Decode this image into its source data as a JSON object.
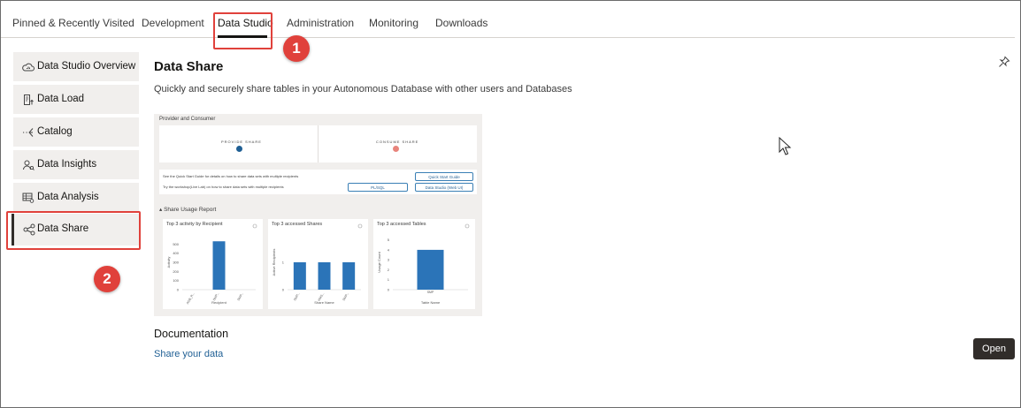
{
  "tabs": [
    {
      "label": "Pinned & Recently Visited"
    },
    {
      "label": "Development"
    },
    {
      "label": "Data Studio",
      "active": true
    },
    {
      "label": "Administration"
    },
    {
      "label": "Monitoring"
    },
    {
      "label": "Downloads"
    }
  ],
  "sidebar": {
    "items": [
      {
        "label": "Data Studio Overview",
        "icon": "cloud-chart-icon"
      },
      {
        "label": "Data Load",
        "icon": "document-upload-icon"
      },
      {
        "label": "Catalog",
        "icon": "catalog-icon"
      },
      {
        "label": "Data Insights",
        "icon": "person-search-icon"
      },
      {
        "label": "Data Analysis",
        "icon": "table-analysis-icon"
      },
      {
        "label": "Data Share",
        "icon": "share-icon",
        "active": true
      }
    ]
  },
  "callouts": [
    {
      "number": "1"
    },
    {
      "number": "2"
    }
  ],
  "main": {
    "title": "Data Share",
    "subtitle": "Quickly and securely share tables in your Autonomous Database with other users and Databases",
    "preview": {
      "header": "Provider and Consumer",
      "provide_label": "PROVIDE SHARE",
      "consume_label": "CONSUME SHARE",
      "guide_text": "See the Quick Start Guide for details on how to share data sets with multiple recipients",
      "workshop_text": "Try the workshop(Live Lab) on how to share data sets with multiple recipients",
      "quick_start_btn": "Quick Start Guide",
      "plsql_btn": "PL/SQL",
      "data_studio_btn": "Data Studio (Web UI)",
      "usage_report": "▴ Share Usage Report",
      "charts": [
        {
          "title": "Top 3 activity by Recipient",
          "ylabel": "Activity",
          "xlabel": "Recipient",
          "yticks": [
            "500",
            "400",
            "300",
            "200",
            "100",
            "0"
          ],
          "categories": [
            "ADB_R...",
            "SMP...",
            "SMP..."
          ],
          "values": [
            0,
            530,
            0
          ],
          "ymax": 600
        },
        {
          "title": "Top 3 accessed Shares",
          "ylabel": "Active Recipients",
          "xlabel": "Share Name",
          "yticks": [
            "1",
            "0"
          ],
          "categories": [
            "SMP...",
            "HMS...",
            "SMP..."
          ],
          "values": [
            1,
            1,
            1
          ],
          "ymax": 2
        },
        {
          "title": "Top 3 accessed Tables",
          "ylabel": "Usage Count",
          "xlabel": "Table Name",
          "yticks": [
            "5",
            "4",
            "3",
            "2",
            "1",
            "0"
          ],
          "categories": [
            "SMP"
          ],
          "values": [
            4
          ],
          "ymax": 5.5
        }
      ]
    },
    "doc_title": "Documentation",
    "doc_link": "Share your data",
    "open_label": "Open"
  },
  "colors": {
    "accent": "#e0413b",
    "bar": "#2b74b8",
    "dark": "#312d2a",
    "link": "#1f5f94"
  }
}
